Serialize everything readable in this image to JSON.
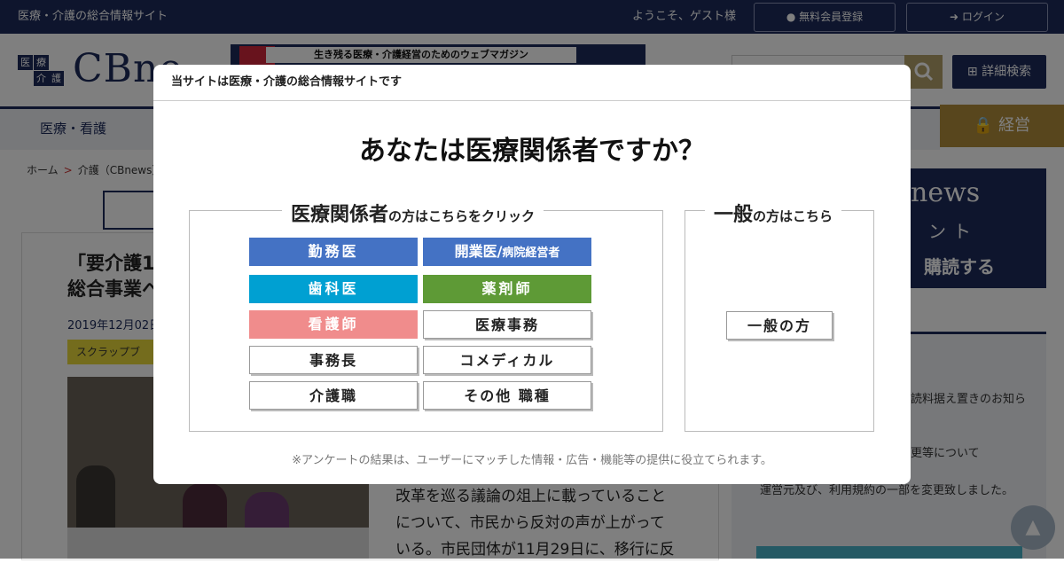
{
  "topbar": {
    "site_name": "医療・介護の総合情報サイト",
    "welcome": "ようこそ、ゲスト様",
    "register_label": "無料会員登録",
    "login_label": "ログイン"
  },
  "header": {
    "logo_text": "CBne",
    "banner_text": "生き残る医療・介護経営のためのウェブマガジン",
    "advanced_search_label": "詳細検索"
  },
  "nav": {
    "first_item": "医療・看護",
    "gold_item": "経営"
  },
  "breadcrumb": {
    "home": "ホーム",
    "current": "介護（CBnews）"
  },
  "article": {
    "title_line1": "「要介護1",
    "title_line2": "総合事業へ",
    "date": "2019年12月02日",
    "scrap_label": "スクラップブ",
    "body_line1": "改革を巡る議論の俎上に載っていること",
    "body_line2": "について、市民から反対の声が上がって",
    "body_line3": "いる。市民団体が11月29日に、移行に反"
  },
  "sidebar": {
    "ad_title": "news",
    "ad_sub": "ント",
    "ad_subscribe": "購読する",
    "item1": "読料据え置きのお知ら",
    "item2": "更等について",
    "item3": "運営元及び、利用規約の一部を変更致しました。"
  },
  "modal": {
    "header": "当サイトは医療・介護の総合情報サイトです",
    "question": "あなたは医療関係者ですか？",
    "medical_legend_big": "医療関係者",
    "medical_legend_small": "の方はこちらをクリック",
    "general_legend_big": "一般",
    "general_legend_small": "の方はこちら",
    "buttons": {
      "kinmui": "勤務医",
      "kaigyoui": "開業医/",
      "kaigyoui_sub": "病院経営者",
      "shikai": "歯科医",
      "yakuzaishi": "薬剤師",
      "kangoshi": "看護師",
      "iryojimu": "医療事務",
      "jimucho": "事務長",
      "comedical": "コメディカル",
      "kaigoshoku": "介護職",
      "sonota": "その他 職種",
      "ippan": "一般の方"
    },
    "note": "※アンケートの結果は、ユーザーにマッチした情報・広告・機能等の提供に役立てられます。"
  },
  "colors": {
    "navy": "#1c2a5a",
    "blue_button": "#4472c4",
    "cyan_button": "#00a0d2",
    "green_button": "#5e9a36",
    "pink_button": "#f08c8c"
  }
}
